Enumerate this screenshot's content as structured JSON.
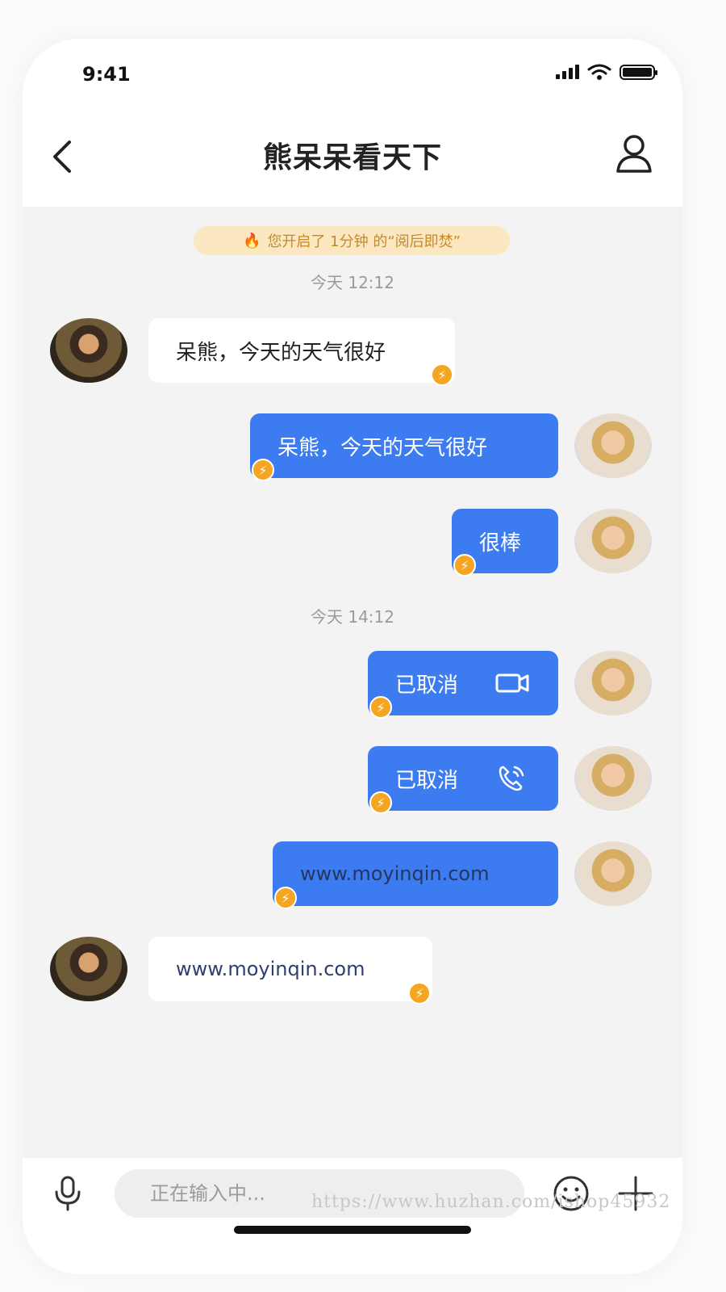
{
  "status_bar": {
    "time": "9:41"
  },
  "header": {
    "title": "熊呆呆看天下"
  },
  "chat": {
    "notice": "您开启了 1分钟 的“阅后即焚”",
    "timestamps": [
      "今天 12:12",
      "今天 14:12"
    ],
    "messages": [
      {
        "side": "left",
        "text": "呆熊，今天的天气很好"
      },
      {
        "side": "right",
        "text": "呆熊，今天的天气很好"
      },
      {
        "side": "right",
        "text": "很棒"
      },
      {
        "side": "right",
        "text": "已取消",
        "icon": "video-call-icon"
      },
      {
        "side": "right",
        "text": "已取消",
        "icon": "phone-call-icon"
      },
      {
        "side": "right",
        "text": "www.moyinqin.com"
      },
      {
        "side": "left",
        "text": "www.moyinqin.com"
      }
    ]
  },
  "input_bar": {
    "placeholder": "正在输入中..."
  },
  "watermark": "https://www.huzhan.com/ishop45932",
  "colors": {
    "outgoing_bubble": "#3d7cf0",
    "incoming_bubble": "#ffffff",
    "burn_badge": "#f4a623",
    "notice_bg": "#fbe7c0"
  }
}
